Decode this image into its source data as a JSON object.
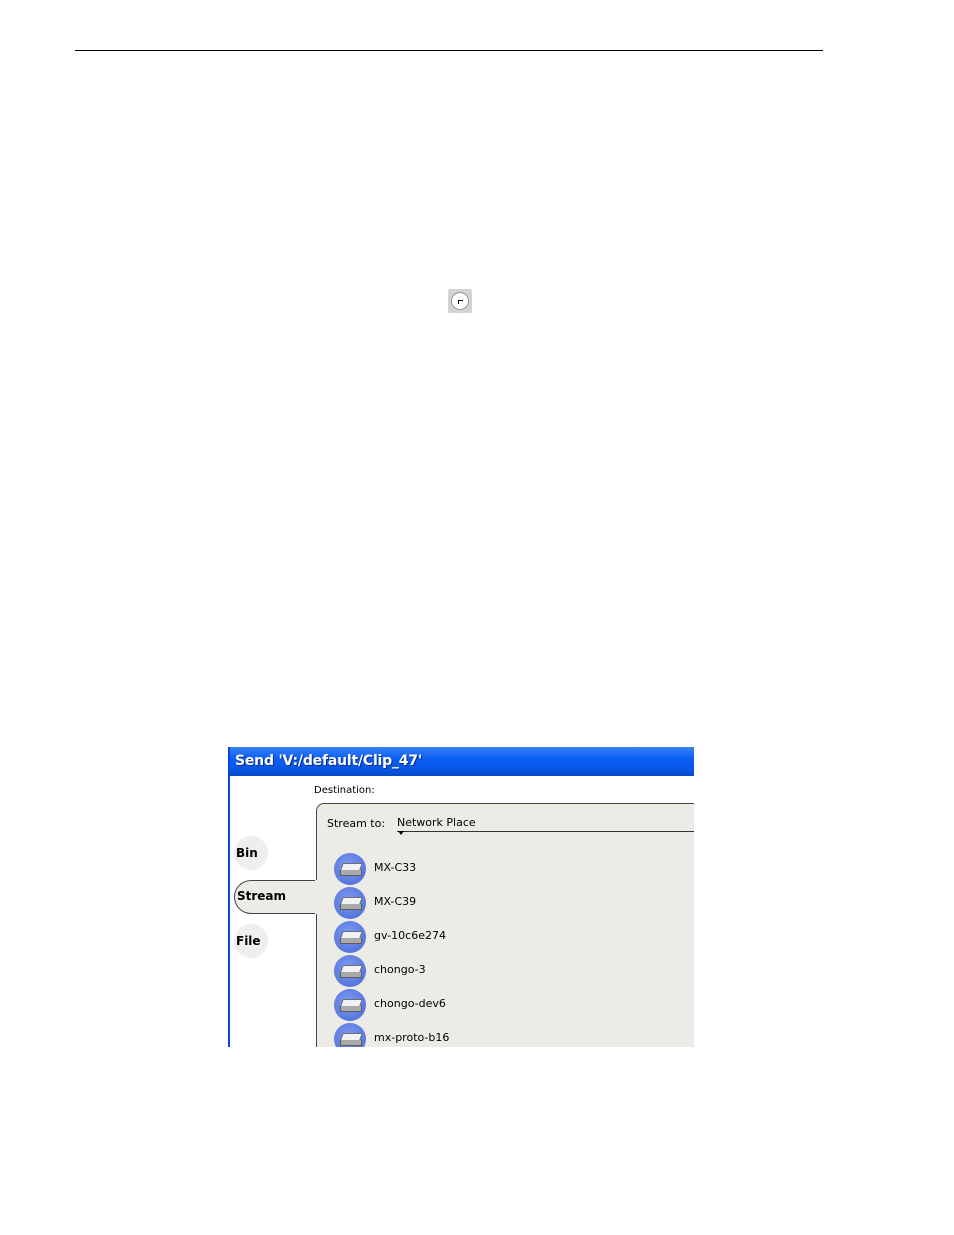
{
  "window": {
    "title": "Send 'V:/default/Clip_47'"
  },
  "destination": {
    "label": "Destination:",
    "stream_to_label": "Stream to:",
    "stream_to_value": "Network Place"
  },
  "tabs": [
    {
      "label": "Bin"
    },
    {
      "label": "Stream"
    },
    {
      "label": "File"
    }
  ],
  "destinations": [
    {
      "name": "MX-C33",
      "icon": "network-disk-icon"
    },
    {
      "name": "MX-C39",
      "icon": "network-disk-icon"
    },
    {
      "name": "gv-10c6e274",
      "icon": "network-disk-icon"
    },
    {
      "name": "chongo-3",
      "icon": "network-disk-icon"
    },
    {
      "name": "chongo-dev6",
      "icon": "network-disk-icon"
    },
    {
      "name": "mx-proto-b16",
      "icon": "network-disk-icon"
    }
  ],
  "colors": {
    "titlebar": "#0b5ef3",
    "panel": "#ecebe6",
    "disk_icon": "#5a79e0"
  }
}
